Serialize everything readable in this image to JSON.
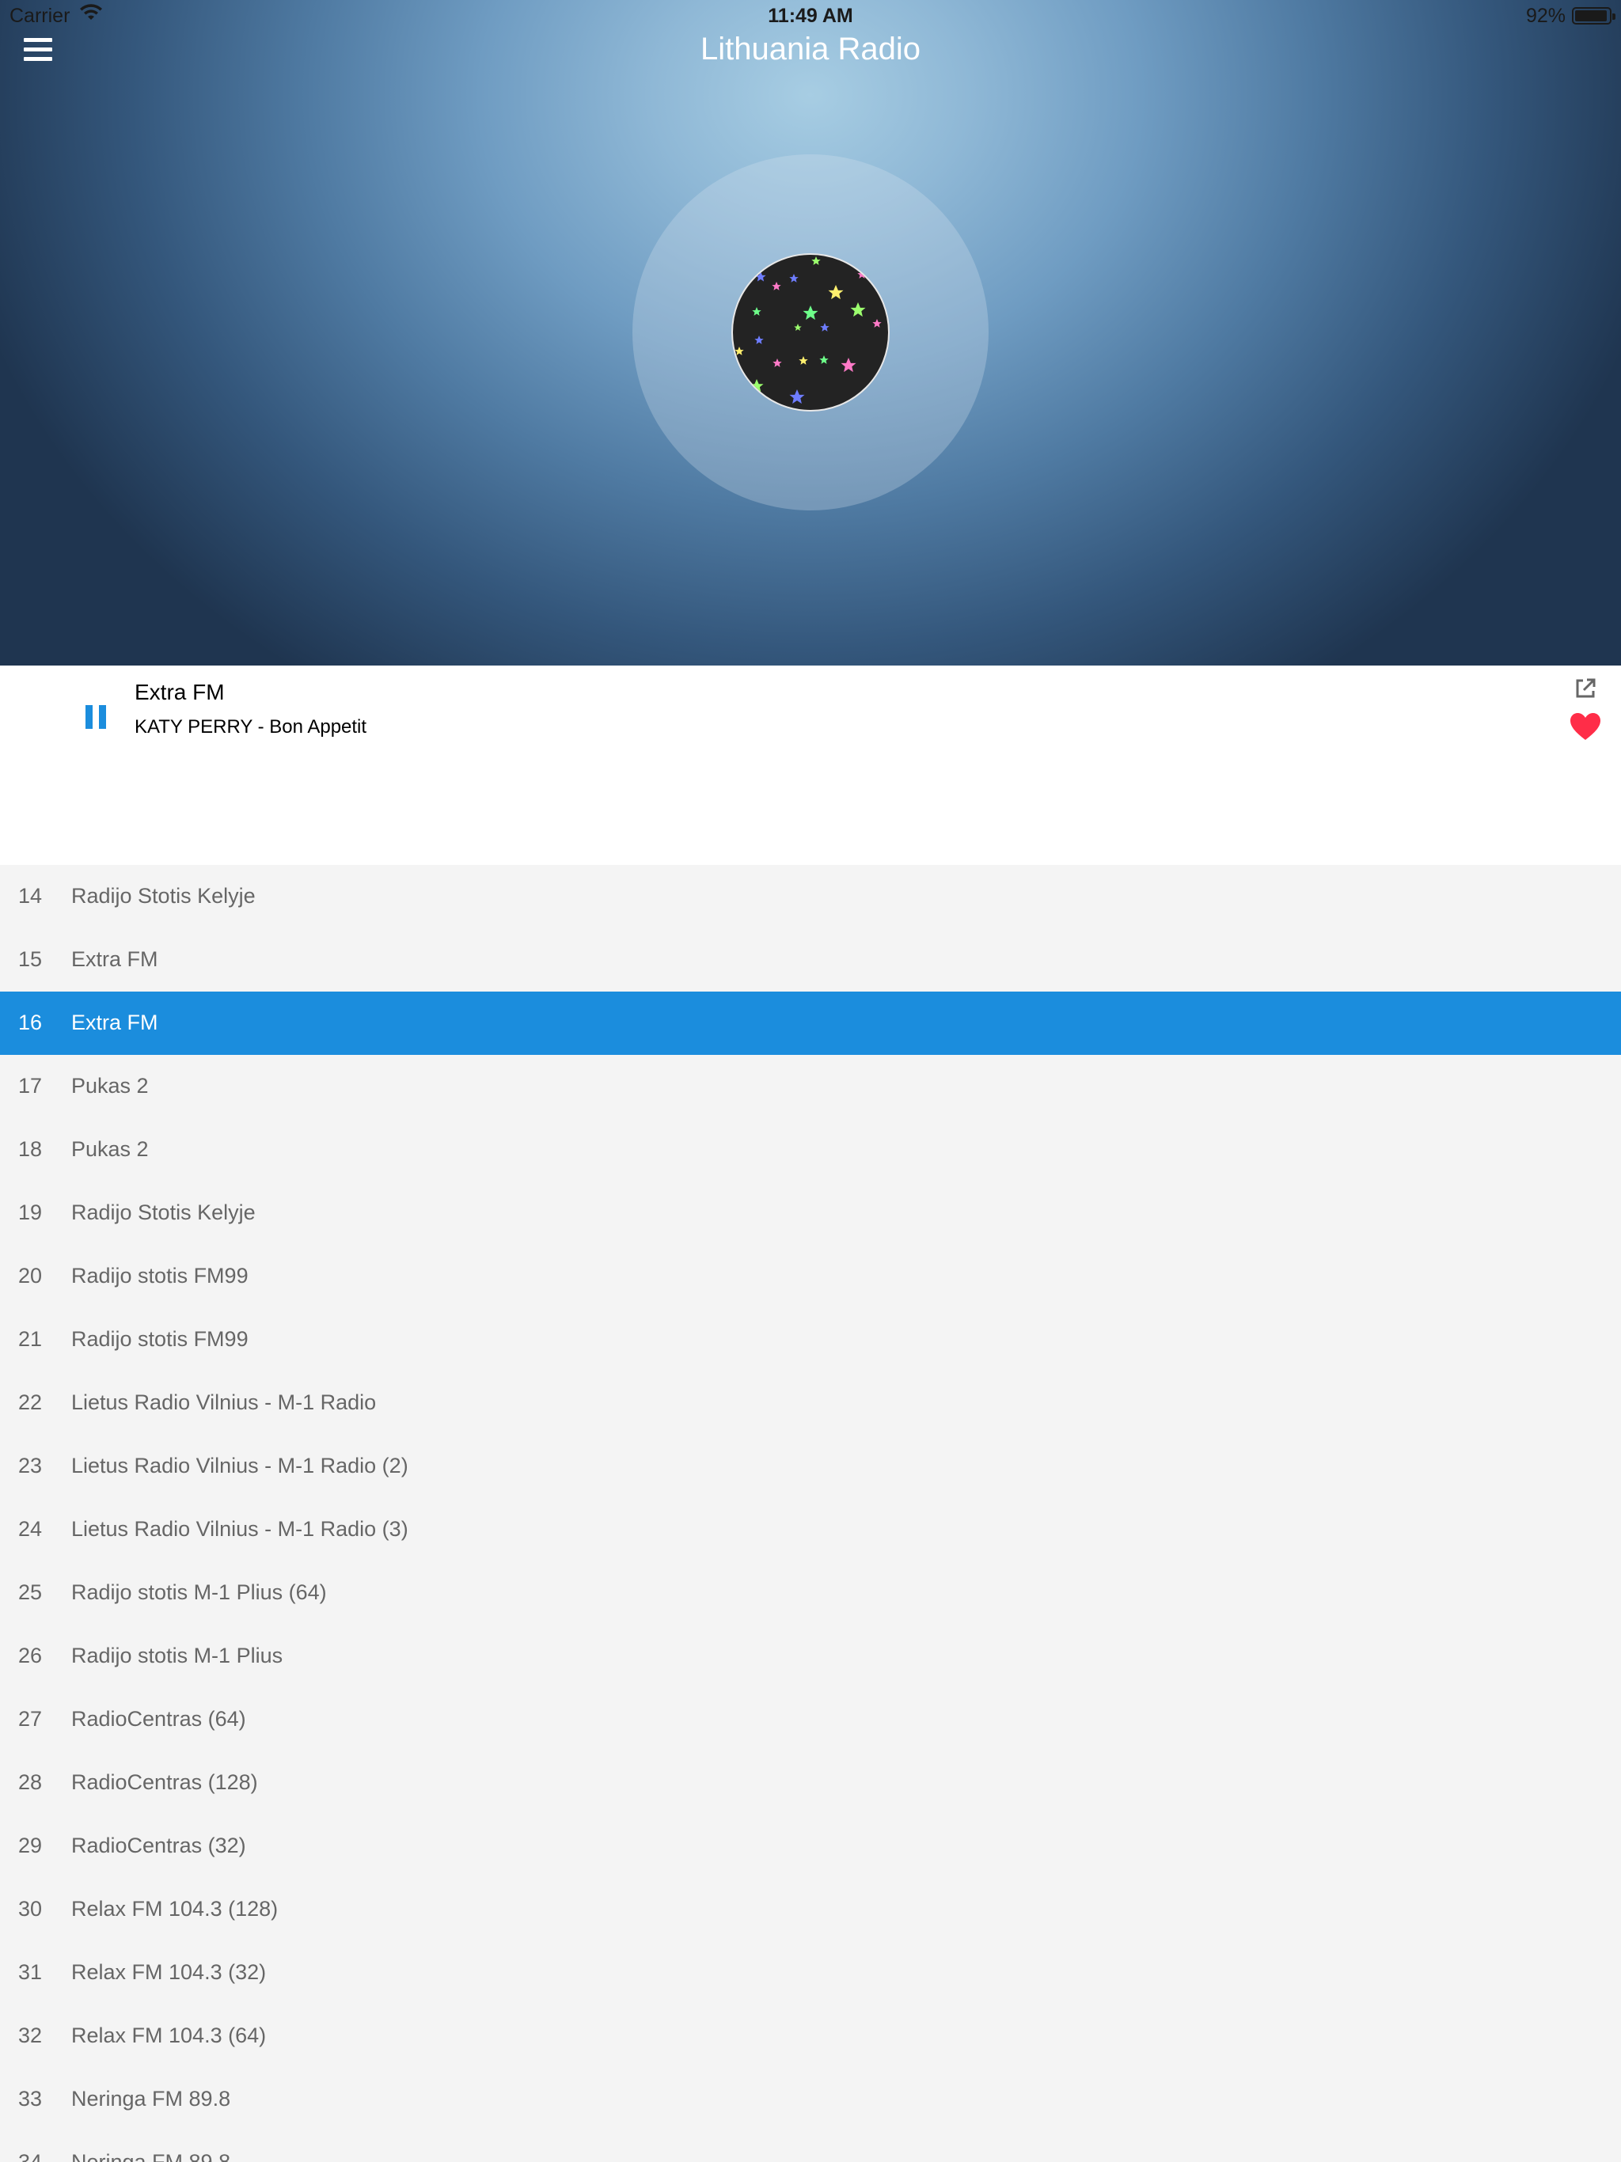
{
  "status_bar": {
    "carrier": "Carrier",
    "time": "11:49 AM",
    "battery": "92%",
    "wifi_icon": "wifi-icon",
    "battery_icon": "battery-icon"
  },
  "header": {
    "title": "Lithuania Radio",
    "menu_icon": "hamburger-menu-icon"
  },
  "artwork": {
    "icon": "stars-artwork"
  },
  "player": {
    "station": "Extra FM",
    "track": "KATY PERRY - Bon Appetit",
    "state": "playing",
    "pause_icon": "pause-icon",
    "share_icon": "share-icon",
    "favorite_icon": "heart-icon",
    "favorited": true,
    "accent_color": "#1b8ddd",
    "favorite_color": "#ff2d48"
  },
  "stations": [
    {
      "num": "14",
      "name": "Radijo Stotis Kelyje"
    },
    {
      "num": "15",
      "name": "Extra FM"
    },
    {
      "num": "16",
      "name": "Extra FM",
      "active": true
    },
    {
      "num": "17",
      "name": "Pukas 2"
    },
    {
      "num": "18",
      "name": "Pukas 2"
    },
    {
      "num": "19",
      "name": "Radijo Stotis Kelyje"
    },
    {
      "num": "20",
      "name": "Radijo stotis FM99"
    },
    {
      "num": "21",
      "name": "Radijo stotis FM99"
    },
    {
      "num": "22",
      "name": "Lietus Radio Vilnius - M-1 Radio"
    },
    {
      "num": "23",
      "name": "Lietus Radio Vilnius - M-1 Radio (2)"
    },
    {
      "num": "24",
      "name": "Lietus Radio Vilnius - M-1 Radio (3)"
    },
    {
      "num": "25",
      "name": "Radijo stotis M-1 Plius (64)"
    },
    {
      "num": "26",
      "name": "Radijo stotis M-1 Plius"
    },
    {
      "num": "27",
      "name": "RadioCentras (64)"
    },
    {
      "num": "28",
      "name": "RadioCentras (128)"
    },
    {
      "num": "29",
      "name": "RadioCentras (32)"
    },
    {
      "num": "30",
      "name": "Relax FM 104.3 (128)"
    },
    {
      "num": "31",
      "name": "Relax FM 104.3 (32)"
    },
    {
      "num": "32",
      "name": "Relax FM 104.3 (64)"
    },
    {
      "num": "33",
      "name": "Neringa FM 89.8"
    },
    {
      "num": "34",
      "name": "Neringa FM 89.8"
    }
  ]
}
